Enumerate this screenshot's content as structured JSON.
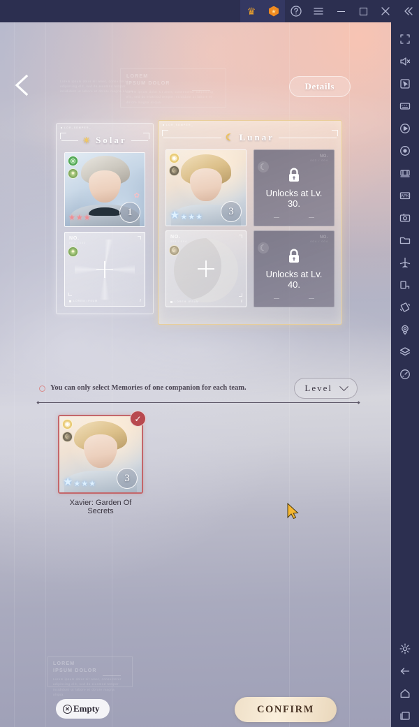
{
  "titlebar": {
    "buttons": [
      {
        "name": "crown-icon",
        "label": "♛"
      },
      {
        "name": "shield-icon",
        "label": "★"
      },
      {
        "name": "help-icon",
        "label": "?"
      },
      {
        "name": "menu-icon",
        "label": "≡"
      },
      {
        "name": "minimize-icon",
        "label": ""
      },
      {
        "name": "maximize-icon",
        "label": ""
      },
      {
        "name": "close-icon",
        "label": "✕"
      },
      {
        "name": "collapse-icon",
        "label": "«"
      }
    ]
  },
  "sidebar": {
    "items": [
      {
        "name": "fullscreen-icon"
      },
      {
        "name": "mute-icon"
      },
      {
        "name": "cursor-tool-icon"
      },
      {
        "name": "keymapping-icon"
      },
      {
        "name": "macro-record-icon"
      },
      {
        "name": "screen-record-icon"
      },
      {
        "name": "multi-instance-icon"
      },
      {
        "name": "apk-install-icon"
      },
      {
        "name": "screenshot-icon"
      },
      {
        "name": "folder-icon"
      },
      {
        "name": "eco-mode-icon"
      },
      {
        "name": "rotate-screen-icon"
      },
      {
        "name": "shake-icon"
      },
      {
        "name": "location-icon"
      },
      {
        "name": "layers-icon"
      },
      {
        "name": "performance-icon"
      }
    ],
    "bottom_items": [
      {
        "name": "settings-icon"
      },
      {
        "name": "back-icon"
      },
      {
        "name": "home-icon"
      },
      {
        "name": "recents-icon"
      }
    ]
  },
  "game": {
    "back_button": "back-chevron-icon",
    "details_button": "Details",
    "watermarks": {
      "title": "LOREM",
      "subtitle": "IPSUM DOLOR",
      "body": "Lorem ipsum dolor sit amet, consectetur adipiscing elit, sed do eiusmod tempor incididunt ut labore et dolore magna aliqua.",
      "tiny": "MAUDE SAPED DAS TIDA NIHE",
      "left_small": "MAUDE SAPED DAS TIDA NIHE"
    },
    "solar_panel": {
      "tag": "LOR_SEMPER_",
      "title": "Solar",
      "icon": "sun-icon",
      "cards": [
        {
          "type": "memory",
          "badges": [
            "ring-green-badge",
            "sun-green-badge"
          ],
          "stars": 3,
          "star_color": "#ef8e94",
          "level": "1"
        },
        {
          "type": "empty",
          "slot_no": "NO.",
          "slot_sub": "002 / 003",
          "badge": "sun-green-badge",
          "foot_label": "LOREM IPSUM",
          "plus": "+"
        }
      ]
    },
    "lunar_panel": {
      "tag": "LOR_SEMPER_",
      "title": "Lunar",
      "icon": "moon-icon",
      "cards": [
        {
          "type": "memory",
          "badges": [
            "sun-gold-badge",
            "moon-dark-badge"
          ],
          "stars": 4,
          "star_color": "#dff1ff",
          "level": "3"
        },
        {
          "type": "locked",
          "lock_text": "Unlocks at Lv. 30.",
          "dim_no": "NO.",
          "dim_sub": "002 / 004",
          "badge": "moon-gray-badge"
        },
        {
          "type": "empty",
          "slot_no": "NO.",
          "slot_sub": "003 / 004",
          "badge": "moon-tan-badge",
          "foot_label": "LOREM IPSUM",
          "plus": "+"
        },
        {
          "type": "locked",
          "lock_text": "Unlocks at Lv. 40.",
          "dim_no": "NO.",
          "dim_sub": "004 / 004",
          "badge": "moon-gray-badge"
        }
      ]
    },
    "notice": {
      "icon": "warning-circle-icon",
      "text": "You can only select Memories of one companion for each team."
    },
    "level_filter": {
      "label": "Level",
      "chevron": "chevron-down-icon"
    },
    "selected_memory": {
      "name": "Xavier: Garden Of Secrets",
      "level": "3",
      "stars": 4,
      "check": "✓",
      "badges": [
        "sun-gold-badge",
        "moon-dark-badge"
      ]
    },
    "empty_button": {
      "label": "Empty",
      "icon": "clear-x-icon",
      "icon_glyph": "✕"
    },
    "confirm_button": "CONFIRM"
  }
}
